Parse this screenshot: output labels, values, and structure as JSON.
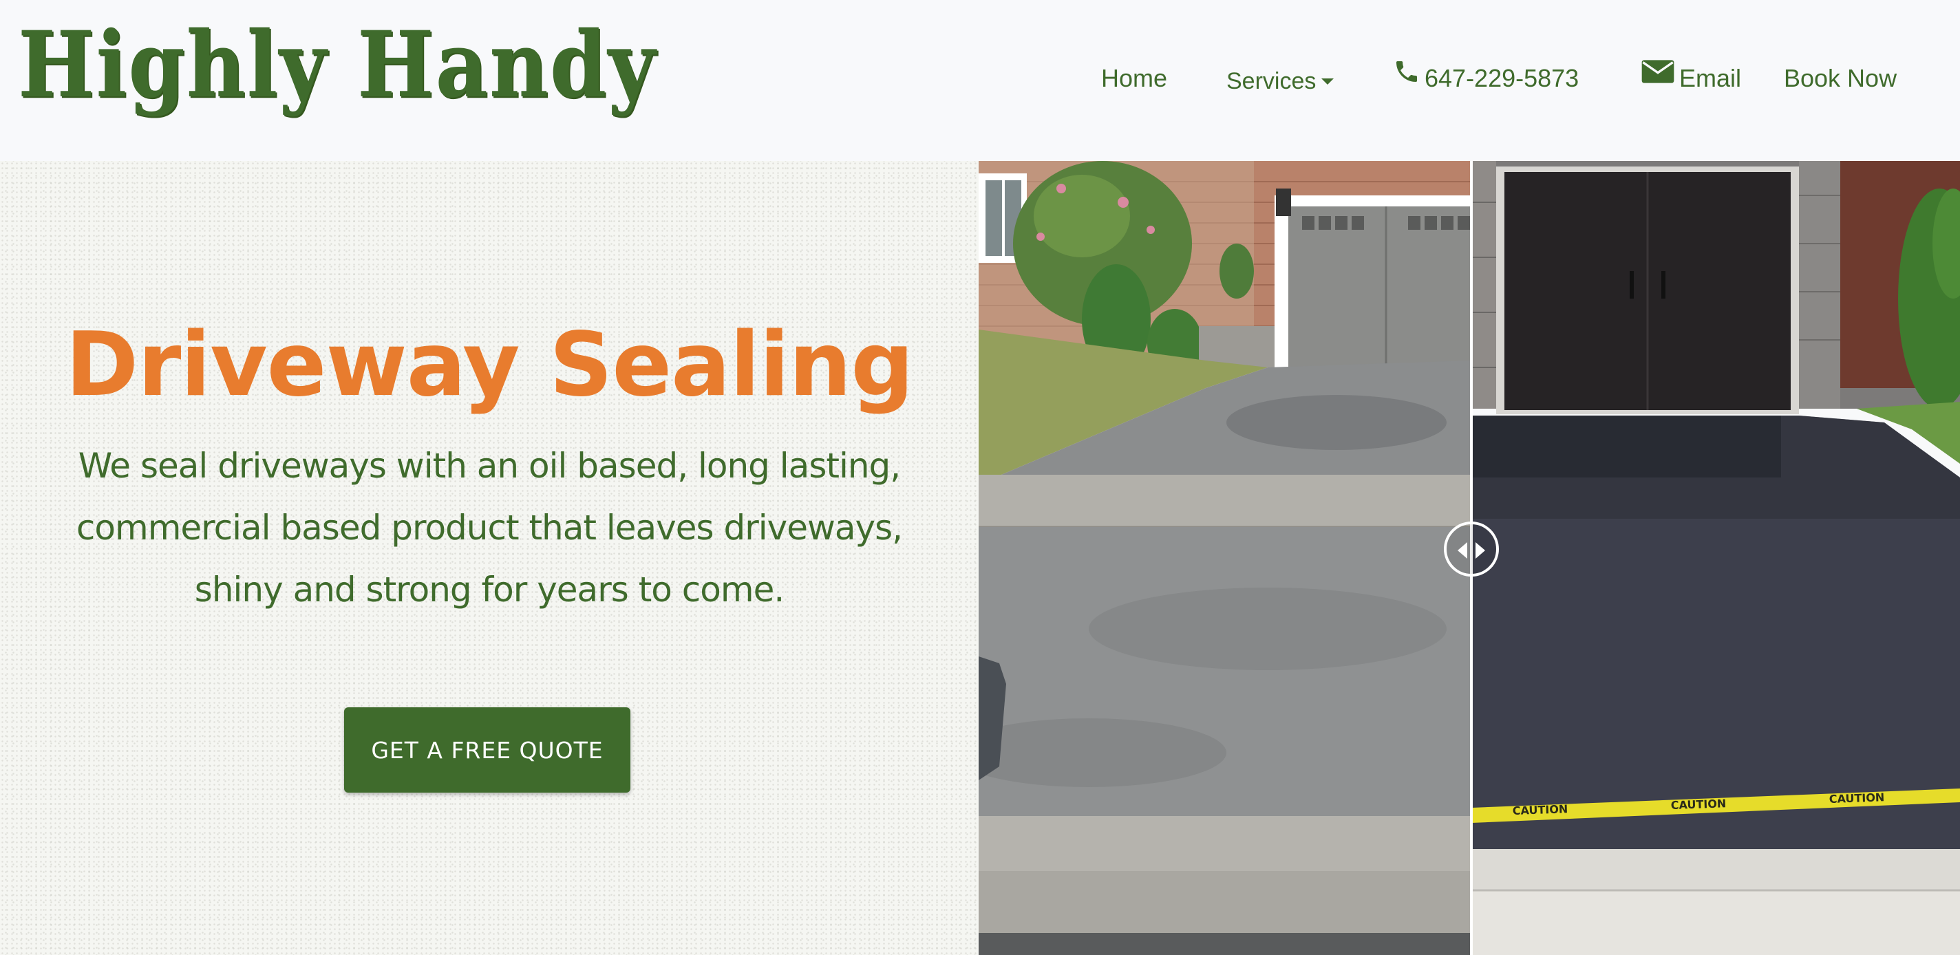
{
  "header": {
    "logo_text": "Highly Handy",
    "nav": {
      "home": "Home",
      "services": "Services",
      "phone": "647-229-5873",
      "email": "Email",
      "book": "Book Now"
    }
  },
  "hero": {
    "title": "Driveway Sealing",
    "description": "We seal driveways with an oil based, long lasting, commercial based product that leaves driveways, shiny and strong for years to come.",
    "cta_label": "GET A FREE QUOTE"
  },
  "colors": {
    "brand_green": "#3f6b2c",
    "accent_orange": "#e87c2e",
    "background": "#f5f6f2"
  },
  "icons": {
    "phone": "phone-icon",
    "email": "envelope-icon",
    "services_dropdown": "chevron-down-icon",
    "compare_handle": "left-right-arrows-icon"
  }
}
